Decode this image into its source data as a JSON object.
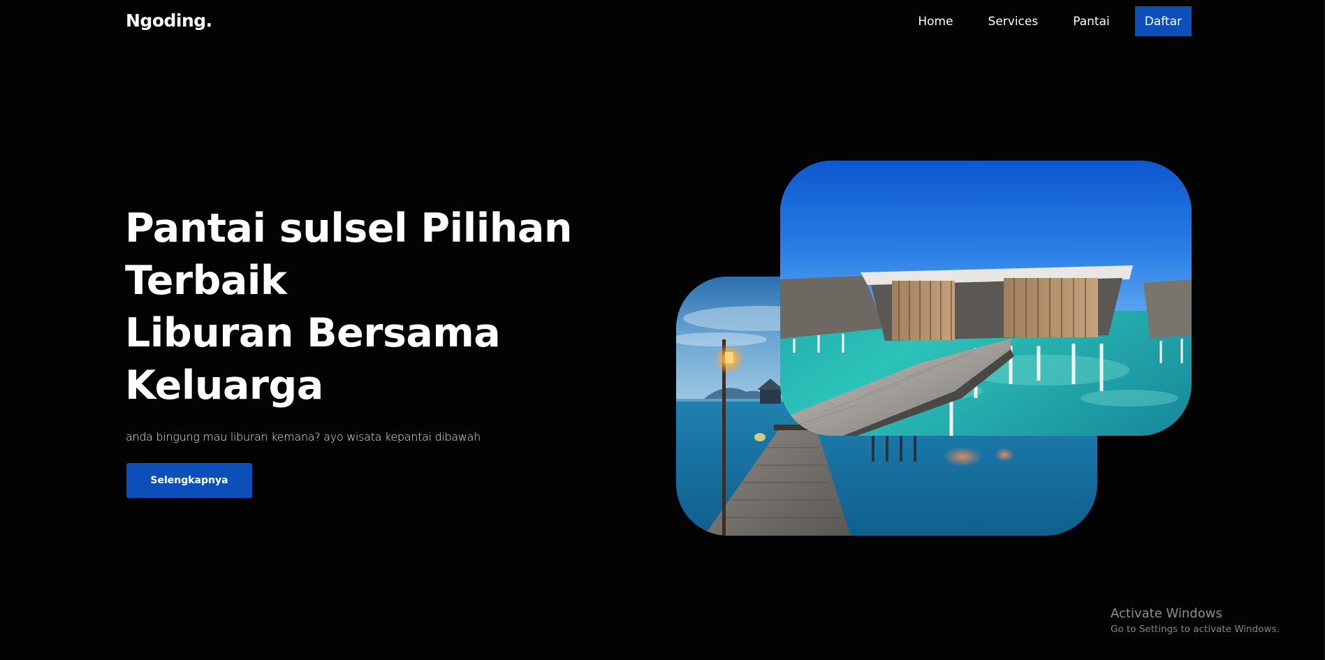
{
  "brand": {
    "logo_text": "Ngoding."
  },
  "nav": {
    "links": [
      {
        "label": "Home"
      },
      {
        "label": "Services"
      },
      {
        "label": "Pantai"
      }
    ],
    "cta_label": "Daftar"
  },
  "hero": {
    "title_lines": [
      "Pantai sulsel Pilihan",
      "Terbaik",
      "Liburan Bersama",
      "Keluarga"
    ],
    "subtitle": "anda bingung mau liburan kemana? ayo wisata kepantai dibawah",
    "button_label": "Selengkapnya"
  },
  "images": {
    "back": {
      "subject": "wooden-pier-at-dusk-image"
    },
    "front": {
      "subject": "overwater-villa-image"
    }
  },
  "os_watermark": {
    "title": "Activate Windows",
    "subtitle": "Go to Settings to activate Windows."
  },
  "colors": {
    "background": "#030303",
    "accent": "#0c4fb8",
    "text": "#ffffff"
  }
}
